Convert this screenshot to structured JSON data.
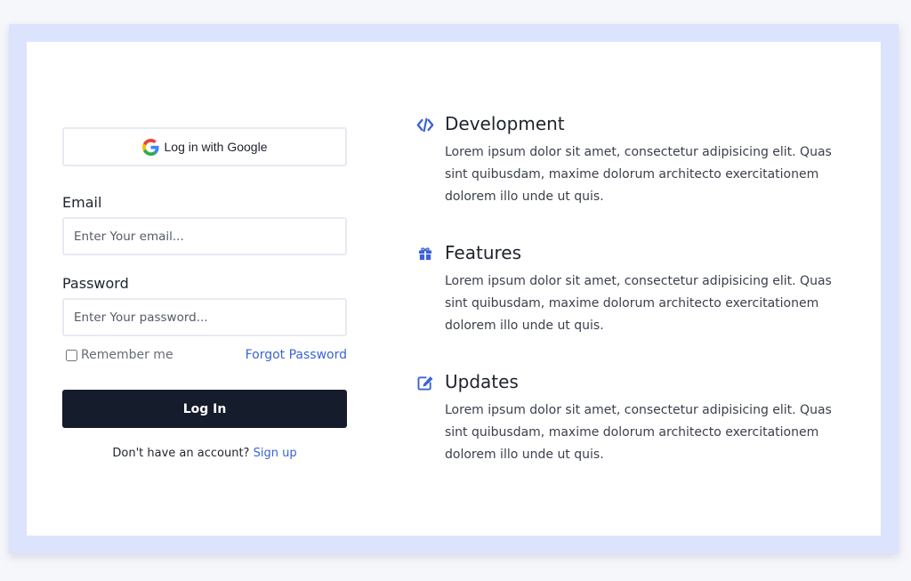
{
  "login": {
    "google_label": "Log in with Google",
    "email_label": "Email",
    "email_placeholder": "Enter Your email...",
    "password_label": "Password",
    "password_placeholder": "Enter Your password...",
    "remember_label": "Remember me",
    "remember_checked": false,
    "forgot_label": "Forgot Password",
    "submit_label": "Log In",
    "signup_prompt": "Don't have an account?",
    "signup_link": "Sign up"
  },
  "features": [
    {
      "icon": "code-icon",
      "title": "Development",
      "description": "Lorem ipsum dolor sit amet, consectetur adipisicing elit. Quas sint quibusdam, maxime dolorum architecto exercitationem dolorem illo unde ut quis."
    },
    {
      "icon": "gift-icon",
      "title": "Features",
      "description": "Lorem ipsum dolor sit amet, consectetur adipisicing elit. Quas sint quibusdam, maxime dolorum architecto exercitationem dolorem illo unde ut quis."
    },
    {
      "icon": "edit-icon",
      "title": "Updates",
      "description": "Lorem ipsum dolor sit amet, consectetur adipisicing elit. Quas sint quibusdam, maxime dolorum architecto exercitationem dolorem illo unde ut quis."
    }
  ],
  "colors": {
    "page_bg": "#f6f7fb",
    "frame_bg": "#dbe3fd",
    "card_bg": "#ffffff",
    "primary_button": "#151c2b",
    "link": "#3b63d6",
    "icon_accent": "#3b63d6"
  }
}
